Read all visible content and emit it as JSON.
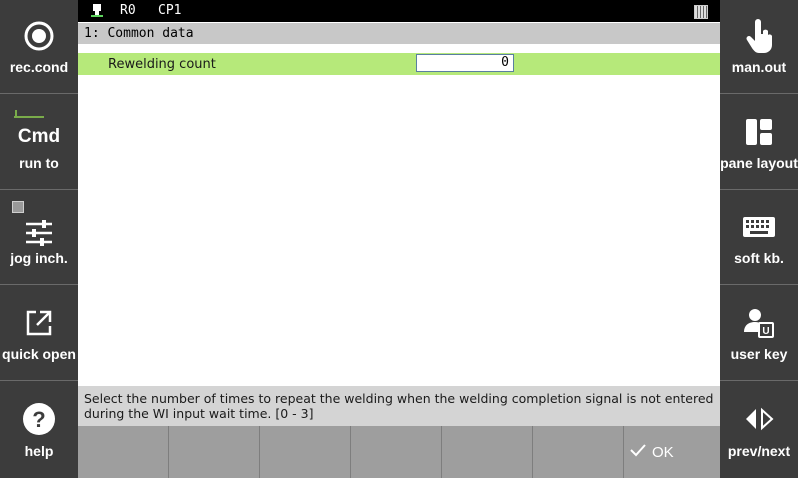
{
  "status_bar": {
    "robot_id": "R0",
    "program": "CP1",
    "robot_icon": "robot-icon",
    "battery_icon": "battery-icon"
  },
  "section": {
    "title": "1: Common data"
  },
  "params": [
    {
      "label": "Rewelding count",
      "value": "0"
    }
  ],
  "help_text": "Select the number of times to repeat the welding when the welding completion signal is not entered during the WI input wait time. [0 - 3]",
  "left_buttons": [
    {
      "label": "rec.cond",
      "icon": "record-icon"
    },
    {
      "label": "run to",
      "icon": "cmd-icon",
      "icon_text": "Cmd"
    },
    {
      "label": "jog inch.",
      "icon": "sliders-icon"
    },
    {
      "label": "quick open",
      "icon": "external-open-icon"
    },
    {
      "label": "help",
      "icon": "help-icon",
      "icon_text": "?"
    }
  ],
  "right_buttons": [
    {
      "label": "man.out",
      "icon": "hand-pointer-icon"
    },
    {
      "label": "pane layout",
      "icon": "layout-icon"
    },
    {
      "label": "soft kb.",
      "icon": "keyboard-icon"
    },
    {
      "label": "user key",
      "icon": "user-key-icon",
      "icon_text": "U"
    },
    {
      "label": "prev/next",
      "icon": "prev-next-icon"
    }
  ],
  "function_keys": [
    "",
    "",
    "",
    "",
    "",
    "",
    "OK"
  ],
  "colors": {
    "side_panel": "#3c3c3c",
    "selected_row": "#b6e97a",
    "section_header": "#c8c8c8",
    "function_bar": "#9e9e9e"
  }
}
